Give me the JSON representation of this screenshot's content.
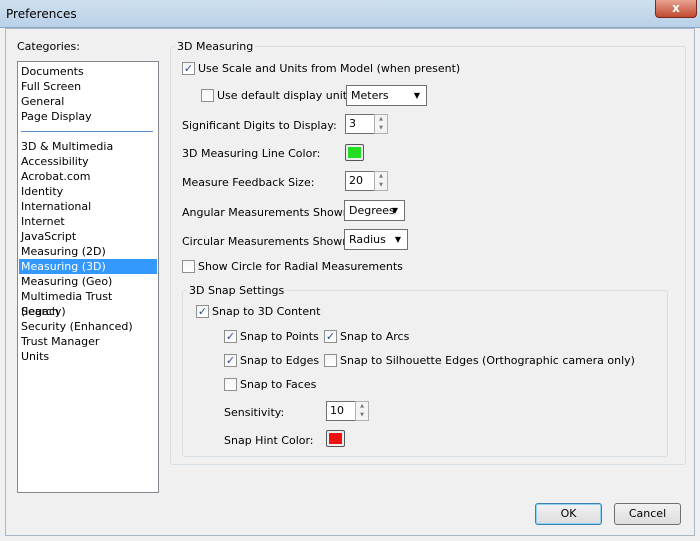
{
  "window": {
    "title": "Preferences",
    "close_label": "x"
  },
  "categories": {
    "label": "Categories:",
    "group1": [
      "Documents",
      "Full Screen",
      "General",
      "Page Display"
    ],
    "group2": [
      "3D & Multimedia",
      "Accessibility",
      "Acrobat.com",
      "Identity",
      "International",
      "Internet",
      "JavaScript",
      "Measuring (2D)",
      "Measuring (3D)",
      "Measuring (Geo)",
      "Multimedia Trust (legacy)",
      "Search",
      "Security (Enhanced)",
      "Trust Manager",
      "Units"
    ],
    "selected": "Measuring (3D)"
  },
  "measuring": {
    "legend": "3D Measuring",
    "use_scale": {
      "label": "Use Scale and Units from Model (when present)",
      "checked": true
    },
    "default_unit": {
      "label": "Use default display unit:",
      "checked": false,
      "value": "Meters"
    },
    "sig_digits": {
      "label": "Significant Digits to Display:",
      "value": "3"
    },
    "line_color": {
      "label": "3D Measuring Line Color:",
      "color": "#22dd22"
    },
    "feedback_size": {
      "label": "Measure Feedback Size:",
      "value": "20"
    },
    "angular": {
      "label": "Angular Measurements Shown In:",
      "value": "Degrees"
    },
    "circular": {
      "label": "Circular Measurements Shown As:",
      "value": "Radius"
    },
    "show_circle": {
      "label": "Show Circle for Radial Measurements",
      "checked": false
    }
  },
  "snap": {
    "legend": "3D Snap Settings",
    "snap_content": {
      "label": "Snap to 3D Content",
      "checked": true
    },
    "points": {
      "label": "Snap to Points",
      "checked": true
    },
    "arcs": {
      "label": "Snap to Arcs",
      "checked": true
    },
    "edges": {
      "label": "Snap to Edges",
      "checked": true
    },
    "silhouette": {
      "label": "Snap to Silhouette Edges (Orthographic camera only)",
      "checked": false
    },
    "faces": {
      "label": "Snap to Faces",
      "checked": false
    },
    "sensitivity": {
      "label": "Sensitivity:",
      "value": "10"
    },
    "hint_color": {
      "label": "Snap Hint Color:",
      "color": "#ee1111"
    }
  },
  "buttons": {
    "ok": "OK",
    "cancel": "Cancel"
  },
  "check_glyph": "✓"
}
